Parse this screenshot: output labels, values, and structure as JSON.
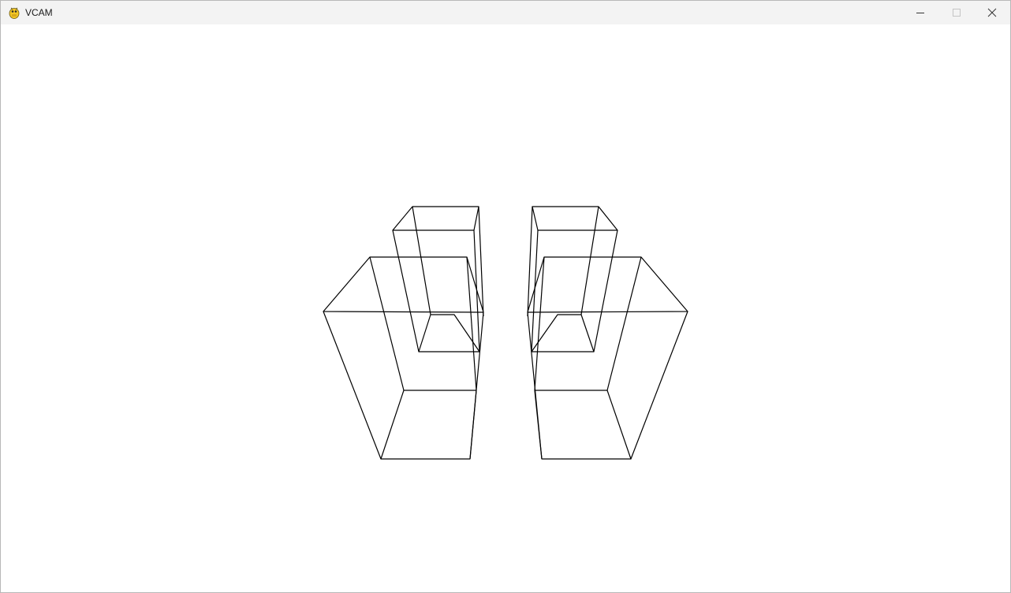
{
  "window": {
    "title": "VCAM",
    "app_icon": "pygame-snake-icon",
    "controls": {
      "minimize_icon": "minimize-icon",
      "maximize_icon": "maximize-icon",
      "close_icon": "close-icon"
    }
  },
  "scene": {
    "background": "#ffffff",
    "line_color": "#000000",
    "shape": "wireframe-boxes",
    "box_count": 4
  }
}
